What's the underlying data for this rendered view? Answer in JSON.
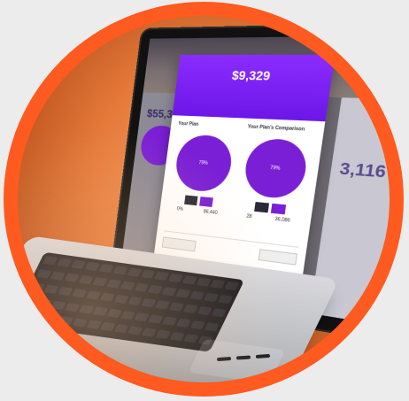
{
  "modal": {
    "amount": "$9,329",
    "col1": {
      "title": "Your Plan",
      "pie_label": "79%",
      "val1": "0%",
      "val2": "86,440"
    },
    "col2": {
      "title": "Your Plan's Comparison",
      "pie_label": "79%",
      "val1": "28",
      "val2": "36,086"
    }
  },
  "background": {
    "left_value": "$55,3",
    "right_value": "3,116"
  },
  "colors": {
    "ring": "#ff5a1f",
    "accent": "#7b1fd6",
    "header": "#6d16e8"
  }
}
